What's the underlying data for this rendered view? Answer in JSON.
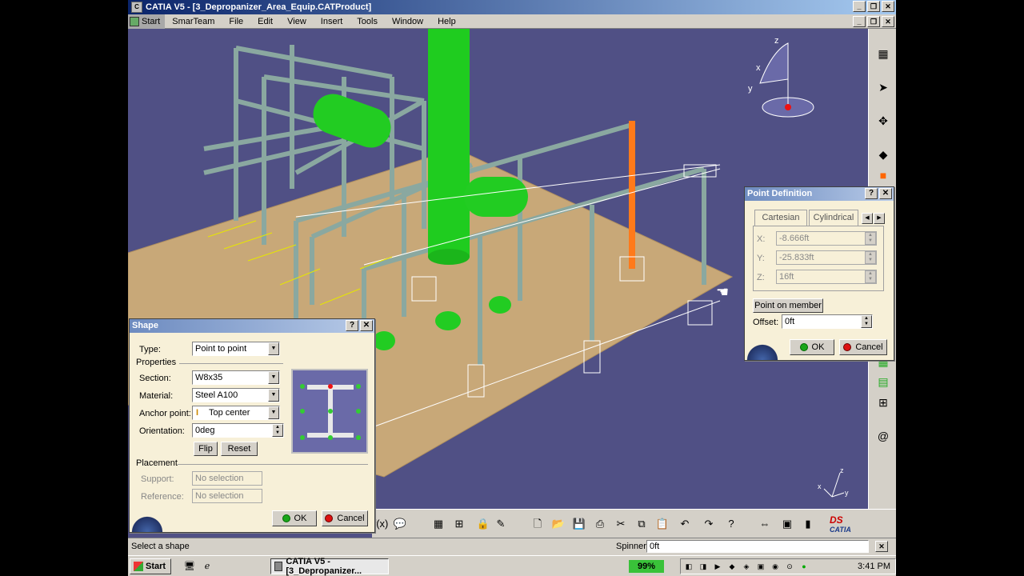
{
  "window": {
    "title": "CATIA V5 - [3_Depropanizer_Area_Equip.CATProduct]"
  },
  "menu": {
    "items": [
      "Start",
      "SmarTeam",
      "File",
      "Edit",
      "View",
      "Insert",
      "Tools",
      "Window",
      "Help"
    ]
  },
  "viewport": {
    "compass": {
      "z_label": "z",
      "x_label": "x",
      "y_label": "y"
    },
    "axis_small": {
      "z_label": "z",
      "x_label": "x",
      "y_label": "y"
    }
  },
  "shape_dialog": {
    "title": "Shape",
    "type_label": "Type:",
    "type_value": "Point to point",
    "properties_label": "Properties",
    "section_label": "Section:",
    "section_value": "W8x35",
    "material_label": "Material:",
    "material_value": "Steel A100",
    "anchor_label": "Anchor point:",
    "anchor_value": "Top center",
    "orientation_label": "Orientation:",
    "orientation_value": "0deg",
    "flip_label": "Flip",
    "reset_label": "Reset",
    "placement_label": "Placement",
    "support_label": "Support:",
    "support_value": "No selection",
    "reference_label": "Reference:",
    "reference_value": "No selection",
    "ok_label": "OK",
    "cancel_label": "Cancel"
  },
  "point_dialog": {
    "title": "Point Definition",
    "tab_cartesian": "Cartesian",
    "tab_cylindrical": "Cylindrical",
    "x_label": "X:",
    "x_value": "-8.666ft",
    "y_label": "Y:",
    "y_value": "-25.833ft",
    "z_label": "Z:",
    "z_value": "16ft",
    "point_on_member_label": "Point on member",
    "offset_label": "Offset:",
    "offset_value": "0ft",
    "ok_label": "OK",
    "cancel_label": "Cancel"
  },
  "statusbar": {
    "message": "Select a shape",
    "spinner_label": "Spinner",
    "spinner_value": "0ft"
  },
  "taskbar": {
    "start_label": "Start",
    "task_label": "CATIA V5 - [3_Depropanizer...",
    "battery": "99%",
    "clock": "3:41 PM"
  },
  "catia_logo": "CATIA",
  "colors": {
    "viewport_bg": "#505085",
    "floor": "#c8a878",
    "structure": "#8aa8a0",
    "equipment": "#22cc22",
    "highlight": "#ff7a1a",
    "dialog_bg": "#f7f0d8"
  }
}
